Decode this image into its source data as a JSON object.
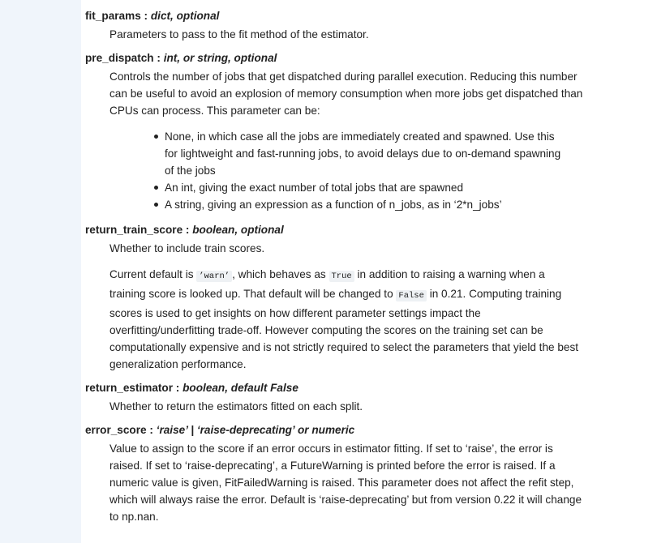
{
  "params": {
    "fit_params": {
      "name": "fit_params",
      "sep": " : ",
      "type": "dict, optional",
      "desc": "Parameters to pass to the fit method of the estimator."
    },
    "pre_dispatch": {
      "name": "pre_dispatch",
      "sep": " : ",
      "type": "int, or string, optional",
      "desc_lines": [
        "Controls the number of jobs that get dispatched during parallel execution. Reducing this number",
        "can be useful to avoid an explosion of memory consumption when more jobs get dispatched than",
        "CPUs can process. This parameter can be:"
      ],
      "bullets": [
        {
          "lines": [
            "None, in which case all the jobs are immediately created and spawned. Use this",
            "for lightweight and fast-running jobs, to avoid delays due to on-demand spawning",
            "of the jobs"
          ]
        },
        {
          "lines": [
            "An int, giving the exact number of total jobs that are spawned"
          ]
        },
        {
          "lines": [
            "A string, giving an expression as a function of n_jobs, as in ‘2*n_jobs’"
          ]
        }
      ]
    },
    "return_train_score": {
      "name": "return_train_score",
      "sep": " : ",
      "type": "boolean, optional",
      "desc1": "Whether to include train scores.",
      "p2": {
        "t1": "Current default is ",
        "code1": "’warn’",
        "t2": ", which behaves as ",
        "code2": "True",
        "t3": " in addition to raising a warning when a",
        "t4": "training score is looked up. That default will be changed to ",
        "code3": "False",
        "t5": " in 0.21. Computing training",
        "rest_lines": [
          "scores is used to get insights on how different parameter settings impact the",
          "overfitting/underfitting trade-off. However computing the scores on the training set can be",
          "computationally expensive and is not strictly required to select the parameters that yield the best",
          "generalization performance."
        ]
      }
    },
    "return_estimator": {
      "name": "return_estimator",
      "sep": " : ",
      "type": "boolean, default False",
      "desc": "Whether to return the estimators fitted on each split."
    },
    "error_score": {
      "name": "error_score",
      "sep": " : ",
      "type": "‘raise’ | ‘raise-deprecating’ or numeric",
      "desc_lines": [
        "Value to assign to the score if an error occurs in estimator fitting. If set to ‘raise’, the error is",
        "raised. If set to ‘raise-deprecating’, a FutureWarning is printed before the error is raised. If a",
        "numeric value is given, FitFailedWarning is raised. This parameter does not affect the refit step,",
        "which will always raise the error. Default is ‘raise-deprecating’ but from version 0.22 it will change",
        "to np.nan."
      ]
    }
  }
}
